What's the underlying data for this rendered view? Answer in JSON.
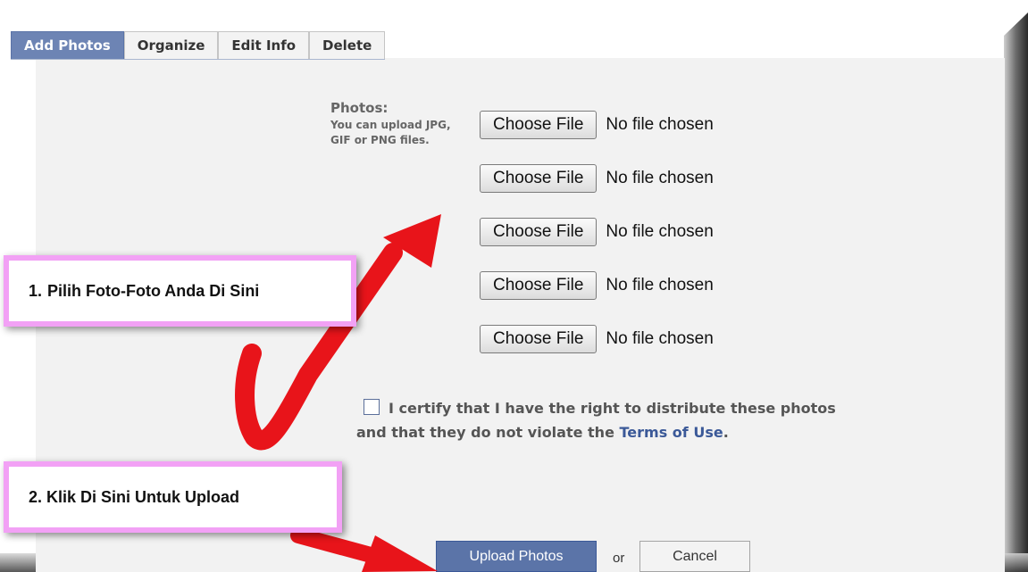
{
  "tabs": [
    {
      "label": "Add Photos",
      "active": true
    },
    {
      "label": "Organize",
      "active": false
    },
    {
      "label": "Edit Info",
      "active": false
    },
    {
      "label": "Delete",
      "active": false
    }
  ],
  "photos": {
    "title": "Photos:",
    "hint": "You can upload JPG, GIF or PNG files."
  },
  "file_inputs": [
    {
      "button": "Choose File",
      "status": "No file chosen"
    },
    {
      "button": "Choose File",
      "status": "No file chosen"
    },
    {
      "button": "Choose File",
      "status": "No file chosen"
    },
    {
      "button": "Choose File",
      "status": "No file chosen"
    },
    {
      "button": "Choose File",
      "status": "No file chosen"
    }
  ],
  "certify": {
    "text": "I certify that I have the right to distribute these photos and that they do not violate the",
    "link": "Terms of Use",
    "end": "."
  },
  "actions": {
    "upload": "Upload Photos",
    "or": "or",
    "cancel": "Cancel"
  },
  "callouts": {
    "step1_num": "1.",
    "step1": "Pilih Foto-Foto Anda Di Sini",
    "step2": "2. Klik Di Sini Untuk Upload"
  },
  "colors": {
    "tab_active": "#6d84b4",
    "primary_button": "#5b74a8",
    "link": "#3b5998",
    "callout_border": "#f2a1f5",
    "arrow": "#e8141a"
  }
}
